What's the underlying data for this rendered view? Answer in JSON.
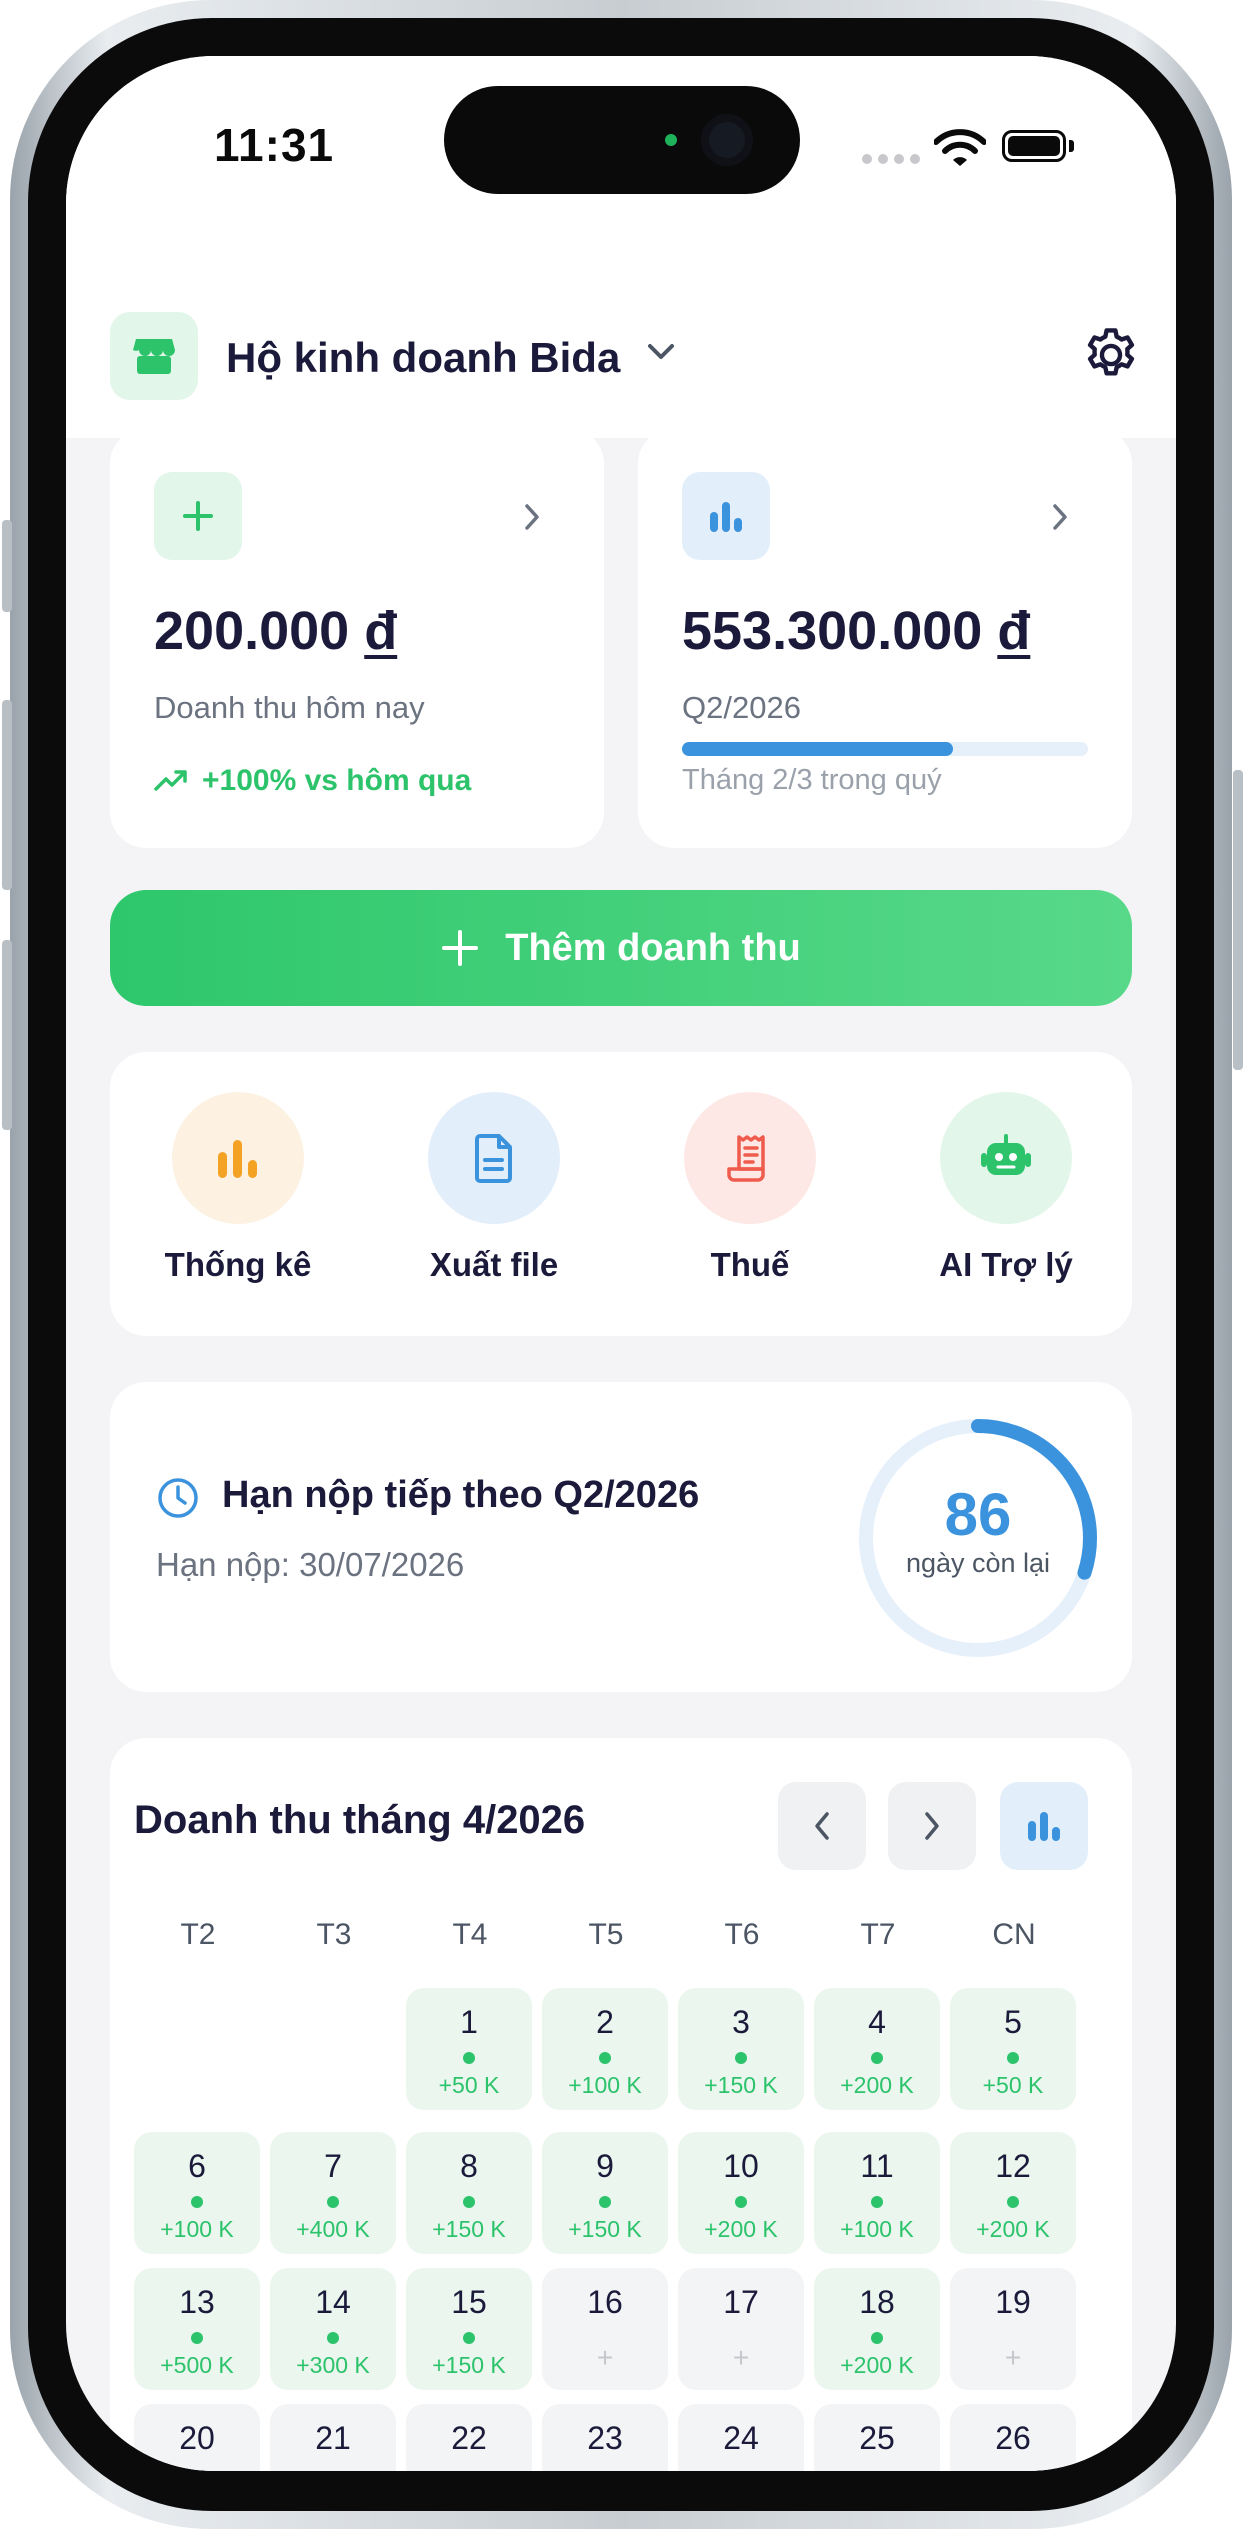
{
  "status_bar": {
    "time": "11:31"
  },
  "header": {
    "business_name": "Hộ kinh doanh Bida"
  },
  "today_card": {
    "amount": "200.000",
    "currency": "đ",
    "label": "Doanh thu hôm nay",
    "trend": "+100% vs hôm qua"
  },
  "quarter_card": {
    "amount": "553.300.000",
    "currency": "đ",
    "period": "Q2/2026",
    "progress_fraction": 0.667,
    "progress_label": "Tháng 2/3 trong quý"
  },
  "add_button": {
    "label": "Thêm doanh thu"
  },
  "quick_actions": [
    {
      "label": "Thống kê",
      "icon": "bar-chart-icon"
    },
    {
      "label": "Xuất file",
      "icon": "document-icon"
    },
    {
      "label": "Thuế",
      "icon": "receipt-icon"
    },
    {
      "label": "AI Trợ lý",
      "icon": "robot-icon"
    }
  ],
  "deadline": {
    "title": "Hạn nộp tiếp theo Q2/2026",
    "date_text": "Hạn nộp: 30/07/2026",
    "days_left": "86",
    "days_label": "ngày còn lại",
    "ring_fraction": 0.3
  },
  "calendar": {
    "title": "Doanh thu tháng 4/2026",
    "weekdays": [
      "T2",
      "T3",
      "T4",
      "T5",
      "T6",
      "T7",
      "CN"
    ],
    "days": [
      {
        "day": "1",
        "amount": "+50 K"
      },
      {
        "day": "2",
        "amount": "+100 K"
      },
      {
        "day": "3",
        "amount": "+150 K"
      },
      {
        "day": "4",
        "amount": "+200 K"
      },
      {
        "day": "5",
        "amount": "+50 K"
      },
      {
        "day": "6",
        "amount": "+100 K"
      },
      {
        "day": "7",
        "amount": "+400 K"
      },
      {
        "day": "8",
        "amount": "+150 K"
      },
      {
        "day": "9",
        "amount": "+150 K"
      },
      {
        "day": "10",
        "amount": "+200 K"
      },
      {
        "day": "11",
        "amount": "+100 K"
      },
      {
        "day": "12",
        "amount": "+200 K"
      },
      {
        "day": "13",
        "amount": "+500 K"
      },
      {
        "day": "14",
        "amount": "+300 K"
      },
      {
        "day": "15",
        "amount": "+150 K"
      },
      {
        "day": "16",
        "amount": "+"
      },
      {
        "day": "17",
        "amount": "+"
      },
      {
        "day": "18",
        "amount": "+200 K"
      },
      {
        "day": "19",
        "amount": "+"
      },
      {
        "day": "20",
        "amount": ""
      },
      {
        "day": "21",
        "amount": ""
      },
      {
        "day": "22",
        "amount": ""
      },
      {
        "day": "23",
        "amount": ""
      },
      {
        "day": "24",
        "amount": ""
      },
      {
        "day": "25",
        "amount": ""
      },
      {
        "day": "26",
        "amount": ""
      }
    ]
  },
  "colors": {
    "accent_green": "#2cc36b",
    "accent_blue": "#3b93dd",
    "text_dark": "#1b1a3a"
  }
}
